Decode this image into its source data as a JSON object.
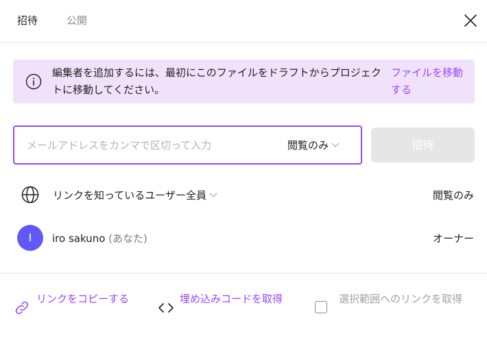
{
  "header": {
    "tabs": [
      "招待",
      "公開"
    ]
  },
  "banner": {
    "message": "編集者を追加するには、最初にこのファイルをドラフトからプロジェクトに移動してください。",
    "action": "ファイルを移動する"
  },
  "invite": {
    "placeholder": "メールアドレスをカンマで区切って入力",
    "value": "",
    "permission": "閲覧のみ",
    "button": "招待"
  },
  "link_access": {
    "label": "リンクを知っているユーザー全員",
    "permission": "閲覧のみ"
  },
  "member": {
    "initial": "I",
    "name": "iro sakuno",
    "you": "(あなた)",
    "role": "オーナー"
  },
  "footer": {
    "copy_link": "リンクをコピーする",
    "embed_code": "埋め込みコードを取得",
    "selection_link": "選択範囲へのリンクを取得"
  },
  "colors": {
    "accent": "#9747ff",
    "banner_bg": "#f1e2fc",
    "avatar": "#6158f7",
    "button_disabled": "#e6e6e6"
  }
}
